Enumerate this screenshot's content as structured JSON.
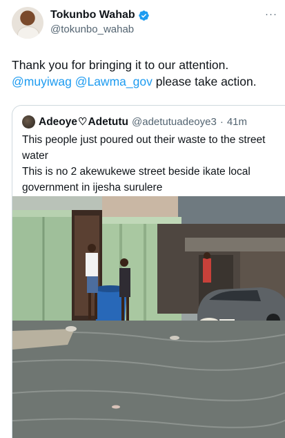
{
  "tweet": {
    "display_name": "Tokunbo Wahab",
    "handle": "@tokunbo_wahab",
    "more_icon": "ellipsis-icon",
    "text_before": "Thank you for bringing it to our attention.",
    "mention_1": "@muyiwag",
    "mention_2": "@Lawma_gov",
    "text_after": " please take action."
  },
  "quote": {
    "display_name_1": "Adeoye",
    "heart": "♡",
    "display_name_2": "Adetutu",
    "handle": "@adetutuadeoye3",
    "separator": "·",
    "time": "41m",
    "line_1": "This people just poured out their waste to the street water",
    "line_2": "This is no 2 akewukewe street beside ikate local government in ijesha surulere"
  },
  "colors": {
    "accent": "#1d9bf0",
    "verified": "#1d9bf0",
    "secondary_text": "#536471",
    "border": "#cfd9de"
  }
}
